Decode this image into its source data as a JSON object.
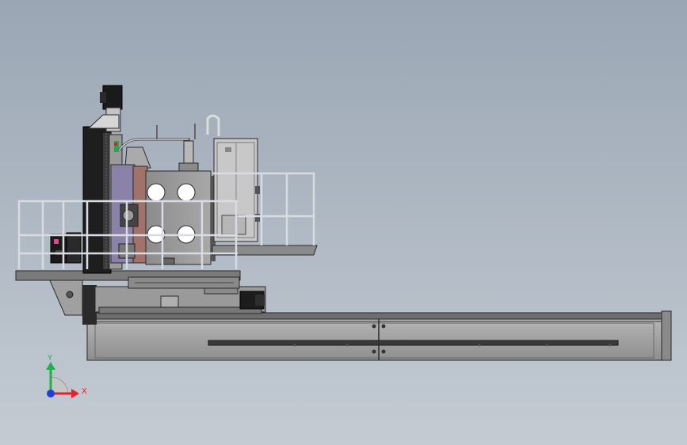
{
  "viewport": {
    "background_top": "#9aa6b4",
    "background_bottom": "#c4cbd3"
  },
  "triad": {
    "x_label": "X",
    "y_label": "Y",
    "x_color": "#e8202a",
    "y_color": "#22b04a",
    "z_color": "#1f3fd8"
  },
  "colors": {
    "steel": "#9a9a9a",
    "steel_dark": "#5a5a5a",
    "outline": "#2a2a2a",
    "column_black": "#1e1e1e",
    "copper_plate": "#a0726a",
    "purple_plate": "#8a82a8",
    "railing": "#d8dce2",
    "cabinet": "#c8c8c8"
  }
}
